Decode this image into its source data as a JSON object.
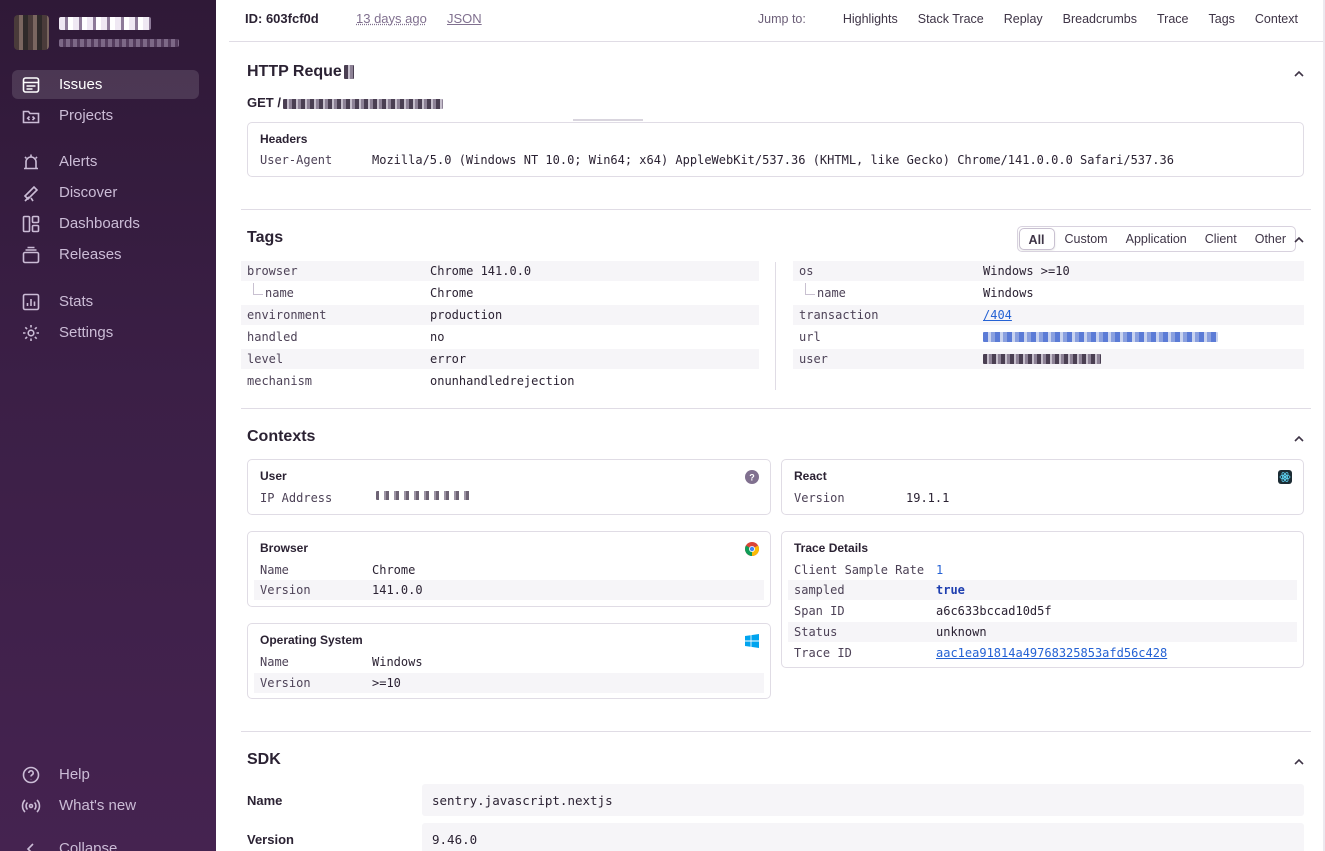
{
  "sidebar": {
    "nav": [
      {
        "label": "Issues",
        "icon": "issues-icon",
        "active": true
      },
      {
        "label": "Projects",
        "icon": "projects-icon"
      },
      {
        "label": "Alerts",
        "icon": "alerts-icon"
      },
      {
        "label": "Discover",
        "icon": "discover-icon"
      },
      {
        "label": "Dashboards",
        "icon": "dashboards-icon"
      },
      {
        "label": "Releases",
        "icon": "releases-icon"
      },
      {
        "label": "Stats",
        "icon": "stats-icon"
      },
      {
        "label": "Settings",
        "icon": "settings-icon"
      }
    ],
    "footer": [
      {
        "label": "Help",
        "icon": "help-icon"
      },
      {
        "label": "What's new",
        "icon": "broadcast-icon"
      },
      {
        "label": "Collapse",
        "icon": "collapse-icon"
      }
    ]
  },
  "topbar": {
    "event_id": "ID: 603fcf0d",
    "time_ago": "13 days ago",
    "json": "JSON",
    "jump_label": "Jump to:",
    "jump_links": [
      "Highlights",
      "Stack Trace",
      "Replay",
      "Breadcrumbs",
      "Trace",
      "Tags",
      "Context"
    ]
  },
  "http": {
    "title": "HTTP Reque",
    "method": "GET /",
    "headers_title": "Headers",
    "headers": [
      {
        "key": "User-Agent",
        "value": "Mozilla/5.0 (Windows NT 10.0; Win64; x64) AppleWebKit/537.36 (KHTML, like Gecko) Chrome/141.0.0.0 Safari/537.36"
      }
    ]
  },
  "tags": {
    "title": "Tags",
    "filters": [
      "All",
      "Custom",
      "Application",
      "Client",
      "Other"
    ],
    "left": [
      {
        "key": "browser",
        "value": "Chrome 141.0.0"
      },
      {
        "key": "name",
        "value": "Chrome",
        "child": true
      },
      {
        "key": "environment",
        "value": "production"
      },
      {
        "key": "handled",
        "value": "no"
      },
      {
        "key": "level",
        "value": "error"
      },
      {
        "key": "mechanism",
        "value": "onunhandledrejection"
      }
    ],
    "right": [
      {
        "key": "os",
        "value": "Windows >=10"
      },
      {
        "key": "name",
        "value": "Windows",
        "child": true
      },
      {
        "key": "transaction",
        "value": "/404",
        "link": true
      },
      {
        "key": "url",
        "value": ""
      },
      {
        "key": "user",
        "value": ""
      }
    ]
  },
  "contexts": {
    "title": "Contexts",
    "user": {
      "title": "User",
      "rows": [
        {
          "key": "IP Address",
          "value": ""
        }
      ]
    },
    "react": {
      "title": "React",
      "rows": [
        {
          "key": "Version",
          "value": "19.1.1"
        }
      ]
    },
    "browser": {
      "title": "Browser",
      "rows": [
        {
          "key": "Name",
          "value": "Chrome"
        },
        {
          "key": "Version",
          "value": "141.0.0"
        }
      ]
    },
    "os": {
      "title": "Operating System",
      "rows": [
        {
          "key": "Name",
          "value": "Windows"
        },
        {
          "key": "Version",
          "value": ">=10"
        }
      ]
    },
    "trace": {
      "title": "Trace Details",
      "rows": [
        {
          "key": "Client Sample Rate",
          "value": "1",
          "color": "#2562d4"
        },
        {
          "key": "sampled",
          "value": "true",
          "bold": true,
          "color": "#1f3fb0"
        },
        {
          "key": "Span ID",
          "value": "a6c633bccad10d5f"
        },
        {
          "key": "Status",
          "value": "unknown"
        },
        {
          "key": "Trace ID",
          "value": "aac1ea91814a49768325853afd56c428",
          "link": true
        }
      ]
    }
  },
  "sdk": {
    "title": "SDK",
    "name_label": "Name",
    "name_value": "sentry.javascript.nextjs",
    "version_label": "Version",
    "version_value": "9.46.0"
  }
}
